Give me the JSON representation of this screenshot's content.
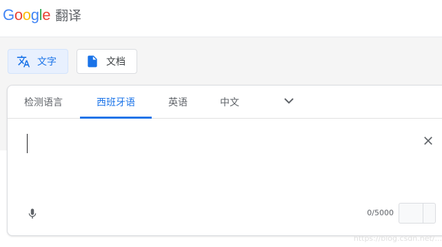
{
  "header": {
    "logo_letters": [
      "G",
      "o",
      "o",
      "g",
      "l",
      "e"
    ],
    "product_name": "翻译"
  },
  "colors": {
    "logo": [
      "#4285F4",
      "#EA4335",
      "#FBBC05",
      "#4285F4",
      "#34A853",
      "#EA4335"
    ],
    "accent": "#1a73e8"
  },
  "modes": {
    "text_label": "文字",
    "doc_label": "文档"
  },
  "languages": {
    "tabs": [
      "检测语言",
      "西班牙语",
      "英语",
      "中文"
    ],
    "active_index": 1
  },
  "input": {
    "value": "",
    "char_count": "0/5000"
  },
  "icons": {
    "text_mode": "translate-icon",
    "doc_mode": "document-icon",
    "more_langs": "chevron-down-icon",
    "clear": "close-icon",
    "mic": "microphone-icon"
  },
  "watermark": "https://blog.csdn.net/..."
}
